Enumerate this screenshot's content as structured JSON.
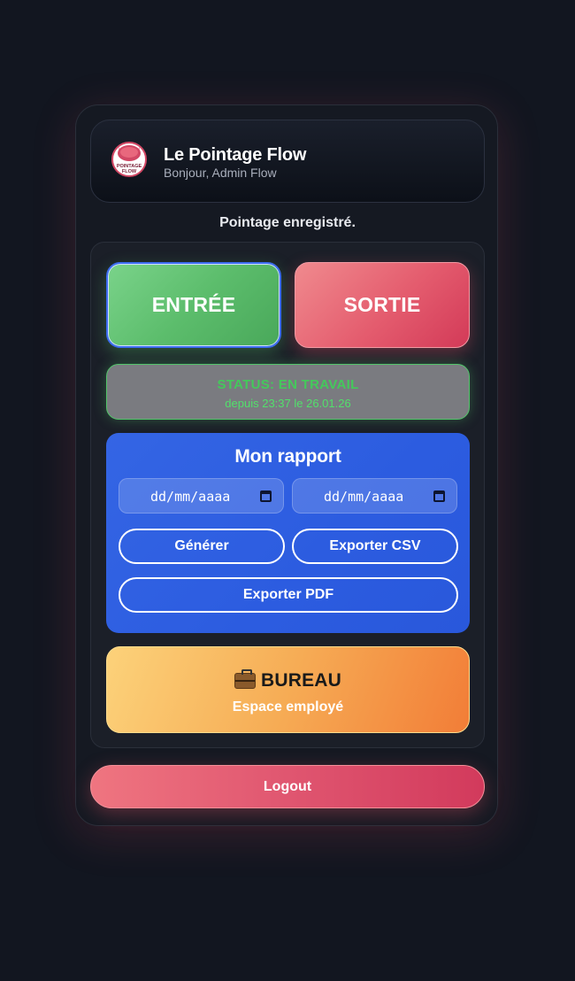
{
  "header": {
    "app_title": "Le Pointage Flow",
    "greeting": "Bonjour, Admin Flow",
    "logo_text_top": "POINTAGE",
    "logo_text_bottom": "FLOW"
  },
  "toast": "Pointage enregistré.",
  "clock": {
    "in_label": "ENTRÉE",
    "out_label": "SORTIE"
  },
  "status": {
    "title": "STATUS: EN TRAVAIL",
    "since": "depuis 23:37 le 26.01.26"
  },
  "report": {
    "title": "Mon rapport",
    "date_from_placeholder": "dd/mm/aaaa",
    "date_to_placeholder": "dd/mm/aaaa",
    "generate_label": "Générer",
    "export_csv_label": "Exporter CSV",
    "export_pdf_label": "Exporter PDF"
  },
  "bureau": {
    "icon": "briefcase-icon",
    "title": "BUREAU",
    "subtitle": "Espace employé"
  },
  "logout_label": "Logout",
  "colors": {
    "background": "#121620",
    "in_green": "#5cbd6c",
    "out_red": "#e45c6e",
    "status_green": "#44c95b",
    "report_blue": "#2c5ce0",
    "bureau_orange": "#f6ac55"
  }
}
